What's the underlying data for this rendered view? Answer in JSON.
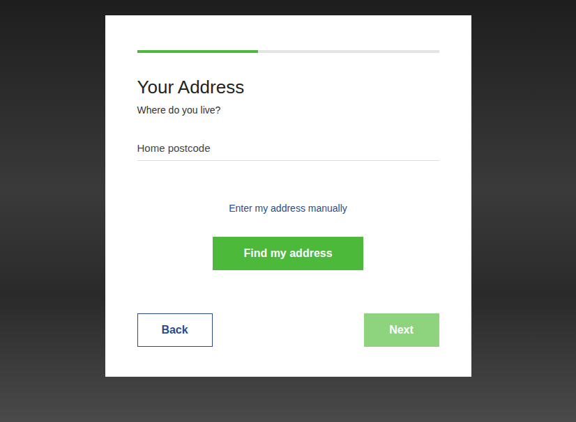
{
  "form": {
    "progress": {
      "level": 0.4
    },
    "title": "Your Address",
    "subtitle": "Where do you live?",
    "field": {
      "placeholder": "Home postcode",
      "value": ""
    },
    "link": "Enter my address manually",
    "find_button": "Find my address"
  },
  "buttons": [
    {
      "label": "Back",
      "kind": "secondary",
      "disabled": false
    },
    {
      "label": "Next",
      "kind": "primary",
      "disabled": true
    }
  ]
}
